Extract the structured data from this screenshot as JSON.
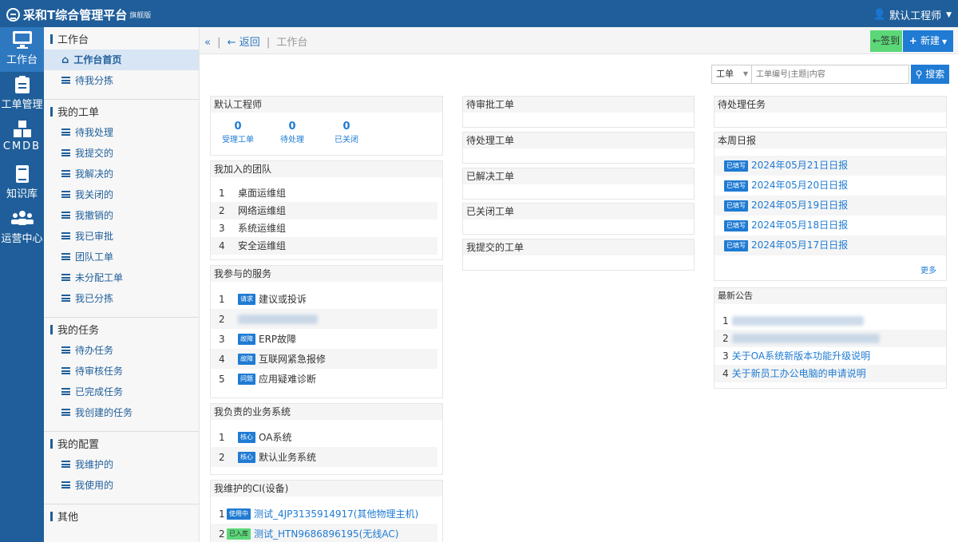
{
  "app": {
    "title": "采和T综合管理平台",
    "edition": "旗舰版",
    "user": "默认工程师"
  },
  "nav": [
    {
      "icon": "monitor-icon",
      "label": "工作台"
    },
    {
      "icon": "clipboard-icon",
      "label": "工单管理"
    },
    {
      "icon": "cubes-icon",
      "label": "CMDB"
    },
    {
      "icon": "book-icon",
      "label": "知识库"
    },
    {
      "icon": "users-icon",
      "label": "运营中心"
    }
  ],
  "sidebar": {
    "workbench": {
      "title": "工作台",
      "items": [
        "工作台首页",
        "待我分拣"
      ]
    },
    "my_tickets": {
      "title": "我的工单",
      "items": [
        "待我处理",
        "我提交的",
        "我解决的",
        "我关闭的",
        "我撤销的",
        "我已审批",
        "团队工单",
        "未分配工单",
        "我已分拣"
      ]
    },
    "my_tasks": {
      "title": "我的任务",
      "items": [
        "待办任务",
        "待审核任务",
        "已完成任务",
        "我创建的任务"
      ]
    },
    "my_config": {
      "title": "我的配置",
      "items": [
        "我维护的",
        "我使用的"
      ]
    },
    "other": {
      "title": "其他"
    }
  },
  "breadcrumb": {
    "back": "返回",
    "current": "工作台"
  },
  "actions": {
    "signin": "签到",
    "new": "新建"
  },
  "search": {
    "type": "工单",
    "placeholder": "工单编号|主题|内容",
    "button": "搜索"
  },
  "user_panel": {
    "title": "默认工程师",
    "stats": [
      {
        "num": "0",
        "label": "受理工单"
      },
      {
        "num": "0",
        "label": "待处理"
      },
      {
        "num": "0",
        "label": "已关闭"
      }
    ]
  },
  "teams": {
    "title": "我加入的团队",
    "items": [
      "桌面运维组",
      "网络运维组",
      "系统运维组",
      "安全运维组"
    ]
  },
  "services": {
    "title": "我参与的服务",
    "items": [
      {
        "idx": "1",
        "tag": "请求",
        "name": "建议或投诉"
      },
      {
        "idx": "2",
        "tag": "",
        "name": ""
      },
      {
        "idx": "3",
        "tag": "故障",
        "name": "ERP故障"
      },
      {
        "idx": "4",
        "tag": "故障",
        "name": "互联网紧急报修"
      },
      {
        "idx": "5",
        "tag": "问题",
        "name": "应用疑难诊断"
      }
    ]
  },
  "business": {
    "title": "我负责的业务系统",
    "items": [
      {
        "idx": "1",
        "tag": "核心",
        "name": "OA系统"
      },
      {
        "idx": "2",
        "tag": "核心",
        "name": "默认业务系统"
      }
    ]
  },
  "ci": {
    "title": "我维护的CI(设备)",
    "items": [
      {
        "idx": "1",
        "tag": "使用中",
        "name": "测试_4JP3135914917(其他物理主机)"
      },
      {
        "idx": "2",
        "tag": "已入库",
        "name": "测试_HTN9686896195(无线AC)"
      }
    ]
  },
  "middle_panels": [
    "待审批工单",
    "待处理工单",
    "已解决工单",
    "已关闭工单",
    "我提交的工单"
  ],
  "pending_tasks": {
    "title": "待处理任务"
  },
  "weekly": {
    "title": "本周日报",
    "tag": "已填写",
    "items": [
      "2024年05月21日日报",
      "2024年05月20日日报",
      "2024年05月19日日报",
      "2024年05月18日日报",
      "2024年05月17日日报"
    ],
    "more": "更多"
  },
  "notices": {
    "title": "最新公告",
    "items": [
      {
        "idx": "1",
        "text": ""
      },
      {
        "idx": "2",
        "text": ""
      },
      {
        "idx": "3",
        "text": "关于OA系统新版本功能升级说明"
      },
      {
        "idx": "4",
        "text": "关于新员工办公电脑的申请说明"
      }
    ]
  }
}
